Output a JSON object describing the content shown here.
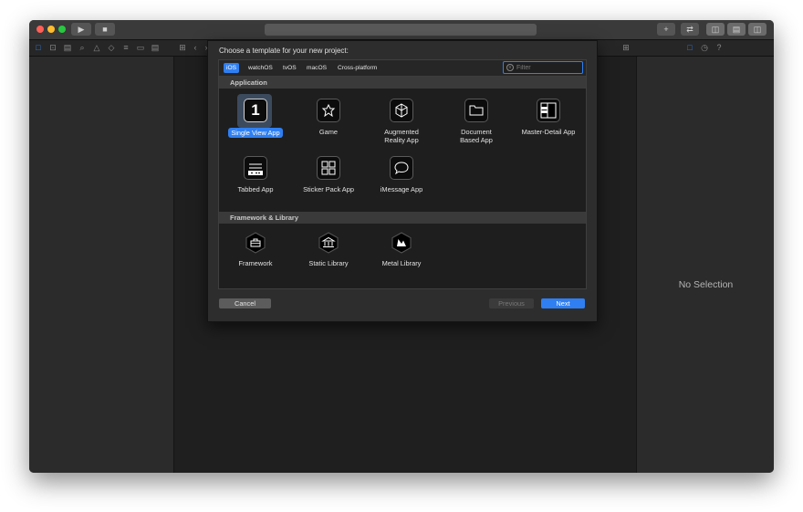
{
  "sheet": {
    "title": "Choose a template for your new project:",
    "platform_tabs": [
      "iOS",
      "watchOS",
      "tvOS",
      "macOS",
      "Cross-platform"
    ],
    "selected_tab": "iOS",
    "filter_placeholder": "Filter",
    "sections": [
      {
        "title": "Application",
        "templates": [
          {
            "label": "Single View App",
            "icon": "single-view-app-icon",
            "selected": true
          },
          {
            "label": "Game",
            "icon": "game-icon"
          },
          {
            "label": "Augmented\nReality App",
            "icon": "augmented-reality-icon"
          },
          {
            "label": "Document\nBased App",
            "icon": "folder-icon"
          },
          {
            "label": "Master-Detail App",
            "icon": "master-detail-icon"
          },
          {
            "label": "Tabbed App",
            "icon": "tabbed-app-icon"
          },
          {
            "label": "Sticker Pack App",
            "icon": "sticker-pack-icon"
          },
          {
            "label": "iMessage App",
            "icon": "message-bubble-icon"
          }
        ]
      },
      {
        "title": "Framework & Library",
        "templates": [
          {
            "label": "Framework",
            "icon": "framework-toolbox-icon"
          },
          {
            "label": "Static Library",
            "icon": "library-building-icon"
          },
          {
            "label": "Metal Library",
            "icon": "metal-icon"
          }
        ]
      }
    ],
    "buttons": {
      "cancel": "Cancel",
      "previous": "Previous",
      "next": "Next"
    },
    "single_view_glyph": "1"
  },
  "inspector": {
    "empty_label": "No Selection"
  },
  "colors": {
    "accent": "#2f7ff2",
    "window_bg": "#1f1f1f",
    "close": "#ff5f57",
    "minimize": "#febc2e",
    "zoom": "#28c840"
  }
}
